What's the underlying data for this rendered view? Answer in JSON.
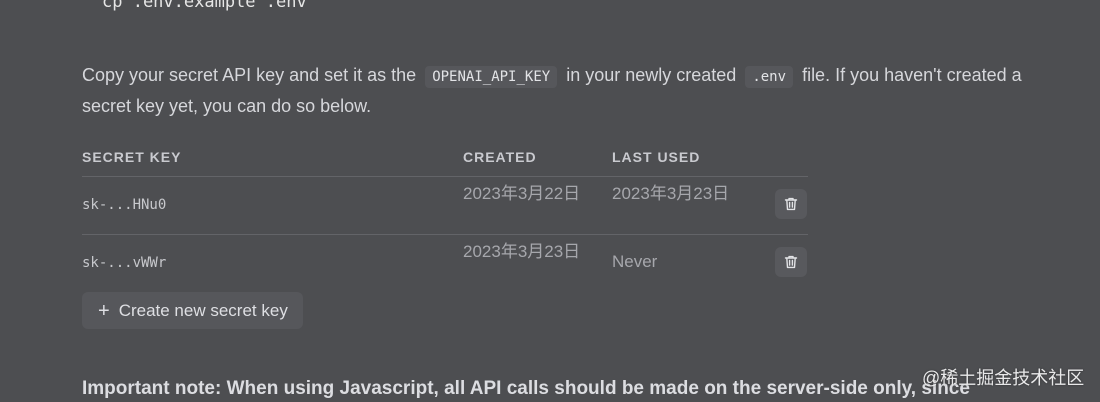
{
  "code_snippet": "cp .env.example .env",
  "intro": {
    "text_before": "Copy your secret API key and set it as the",
    "env_var": "OPENAI_API_KEY",
    "text_middle": "in your newly created",
    "env_file": ".env",
    "text_after": "file. If you haven't created a secret key yet, you can do so below."
  },
  "table": {
    "headers": {
      "secret_key": "SECRET KEY",
      "created": "CREATED",
      "last_used": "LAST USED"
    },
    "rows": [
      {
        "key": "sk-...HNu0",
        "created": "2023年3月22日",
        "last_used": "2023年3月23日"
      },
      {
        "key": "sk-...vWWr",
        "created": "2023年3月23日",
        "last_used": "Never"
      }
    ]
  },
  "create_button": {
    "icon": "plus-icon",
    "label": "Create new secret key"
  },
  "delete_icon": "trash-icon",
  "important_note": "Important note: When using Javascript, all API calls should be made on the server-side only, since",
  "watermark": "@稀土掘金技术社区",
  "colors": {
    "background": "#4d4e51",
    "chip": "#56575b",
    "text": "#d6d7db",
    "muted": "#a6a7ac"
  }
}
